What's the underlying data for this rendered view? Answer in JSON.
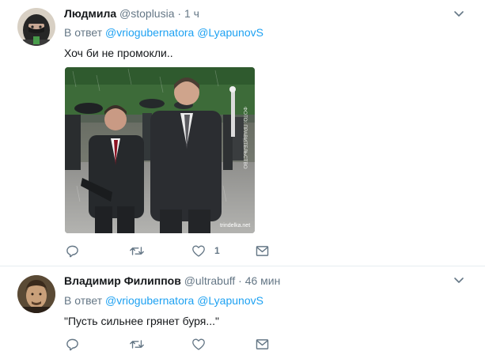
{
  "tweets": [
    {
      "name": "Людмила",
      "handle": "@stoplusia",
      "separator": "·",
      "time": "1 ч",
      "reply_prefix": "В ответ",
      "reply_user1": "@vriogubernatora",
      "reply_user2": "@LyapunovS",
      "text": "Хоч би не промокли..",
      "image_watermark": "trindelka.net",
      "image_side_text": "ФОТО: ПРАВИТЕЛЬСТВО",
      "replies_count": "",
      "retweets_count": "",
      "likes_count": "1"
    },
    {
      "name": "Владимир Филиппов",
      "handle": "@ultrabuff",
      "separator": "·",
      "time": "46 мин",
      "reply_prefix": "В ответ",
      "reply_user1": "@vriogubernatora",
      "reply_user2": "@LyapunovS",
      "text": "\"Пусть сильнее грянет буря...\"",
      "replies_count": "",
      "retweets_count": "",
      "likes_count": ""
    }
  ],
  "colors": {
    "link": "#1da1f2",
    "secondary": "#657786",
    "divider": "#e6ecf0"
  },
  "icons": [
    "reply-icon",
    "retweet-icon",
    "like-icon",
    "direct-message-icon",
    "chevron-down-icon"
  ]
}
